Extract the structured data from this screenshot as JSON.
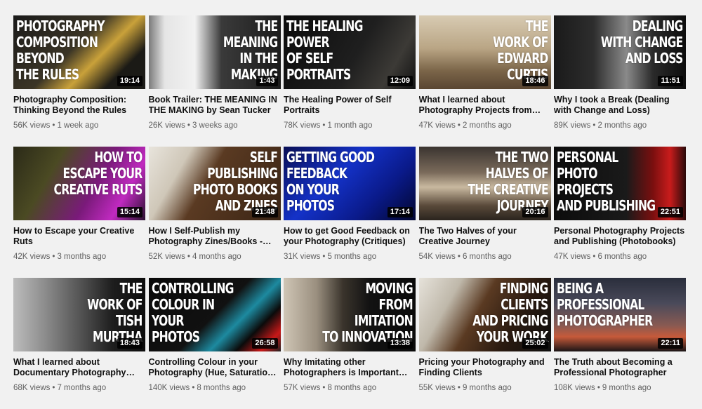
{
  "videos": [
    {
      "thumb_text": "PHOTOGRAPHY\nCOMPOSITION\nBEYOND\nTHE RULES",
      "align": "left",
      "bg": "linear-gradient(135deg,#1a1a1a 0%,#3b3526 45%,#c9a13a 62%,#1b1a16 80%)",
      "duration": "19:14",
      "title": "Photography Composition: Thinking Beyond the Rules",
      "views": "56K views",
      "age": "1 week ago"
    },
    {
      "thumb_text": "THE\nMEANING\nIN THE\nMAKING",
      "align": "right",
      "bg": "linear-gradient(90deg,#7b7b7b 0%,#e5e5e5 12%,#f2f2f2 35%,#3a3a3a 55%,#1c1c1c 100%)",
      "duration": "1:43",
      "title": "Book Trailer: THE MEANING IN THE MAKING by Sean Tucker",
      "views": "26K views",
      "age": "3 weeks ago"
    },
    {
      "thumb_text": "THE HEALING\nPOWER\nOF SELF\nPORTRAITS",
      "align": "left",
      "bg": "linear-gradient(120deg,#0b0b0b 0%,#1f1f1f 55%,#3c3a36 80%,#111 100%)",
      "duration": "12:09",
      "title": "The Healing Power of Self Portraits",
      "views": "78K views",
      "age": "1 month ago"
    },
    {
      "thumb_text": "THE\nWORK OF\nEDWARD\nCURTIS",
      "align": "right",
      "bg": "linear-gradient(180deg,#d8cbb3 0%,#b9a584 45%,#7b6549 75%,#5a4632 100%)",
      "duration": "18:46",
      "title": "What I learned about Photography Projects from Edward Curtis",
      "views": "47K views",
      "age": "2 months ago"
    },
    {
      "thumb_text": "DEALING\nWITH CHANGE\nAND LOSS",
      "align": "right",
      "bg": "linear-gradient(90deg,#1a1a1a 0%,#2d2d2d 30%,#8a8a8a 55%,#2a2a2a 75%,#0d0d0d 100%)",
      "duration": "11:51",
      "title": "Why I took a Break (Dealing with Change and Loss)",
      "views": "89K views",
      "age": "2 months ago"
    },
    {
      "thumb_text": "HOW TO\nESCAPE YOUR\nCREATIVE RUTS",
      "align": "right",
      "bg": "linear-gradient(120deg,#2b2a18 0%,#4b4a23 30%,#7a1a7a 60%,#c02ac0 80%,#2a1030 100%)",
      "duration": "15:14",
      "title": "How to Escape your Creative Ruts",
      "views": "42K views",
      "age": "3 months ago"
    },
    {
      "thumb_text": "SELF\nPUBLISHING\nPHOTO BOOKS\nAND ZINES",
      "align": "right",
      "bg": "linear-gradient(120deg,#e8e4dc 0%,#cfc7b8 25%,#5a3a22 45%,#3a2414 100%)",
      "duration": "21:48",
      "title": "How I Self-Publish my Photography Zines/Books - Self Publishing",
      "views": "52K views",
      "age": "4 months ago"
    },
    {
      "thumb_text": "GETTING GOOD\nFEEDBACK\nON YOUR\nPHOTOS",
      "align": "left",
      "bg": "linear-gradient(135deg,#0a0f55 0%,#1432c8 40%,#0a1a8a 70%,#020630 100%)",
      "duration": "17:14",
      "title": "How to get Good Feedback on your Photography (Critiques)",
      "views": "31K views",
      "age": "5 months ago"
    },
    {
      "thumb_text": "THE TWO\nHALVES OF\nTHE CREATIVE\nJOURNEY",
      "align": "right",
      "bg": "linear-gradient(180deg,#3a3430 0%,#7a6a5a 35%,#c9b9a0 55%,#5a4a3a 80%,#2a241e 100%)",
      "duration": "20:16",
      "title": "The Two Halves of your Creative Journey",
      "views": "54K views",
      "age": "6 months ago"
    },
    {
      "thumb_text": "PERSONAL\nPHOTO\nPROJECTS\nAND PUBLISHING",
      "align": "left",
      "bg": "linear-gradient(90deg,#0c0c0c 0%,#1a1a1a 55%,#7a0f0f 75%,#c81c1c 88%,#2a0a0a 100%)",
      "duration": "22:51",
      "title": "Personal Photography Projects and Publishing (Photobooks)",
      "views": "47K views",
      "age": "6 months ago"
    },
    {
      "thumb_text": "THE\nWORK OF\nTISH\nMURTHA",
      "align": "right",
      "bg": "linear-gradient(90deg,#bdbdbd 0%,#8a8a8a 25%,#555 50%,#1e1e1e 75%,#0c0c0c 100%)",
      "duration": "18:43",
      "title": "What I learned about Documentary Photography from Tish Murtha",
      "views": "68K views",
      "age": "7 months ago"
    },
    {
      "thumb_text": "CONTROLLING\nCOLOUR IN\nYOUR\nPHOTOS",
      "align": "left",
      "bg": "linear-gradient(135deg,#0a0a0a 0%,#111 50%,#1d8aa0 65%,#0b0b0b 78%,#c81818 90%,#222 100%)",
      "duration": "26:58",
      "title": "Controlling Colour in your Photography (Hue, Saturation, Luminance)",
      "views": "140K views",
      "age": "8 months ago"
    },
    {
      "thumb_text": "MOVING\nFROM\nIMITATION\nTO INNOVATION",
      "align": "right",
      "bg": "linear-gradient(90deg,#cfc5b5 0%,#9a8f7f 25%,#3a342c 45%,#121212 65%,#0a0a0a 100%)",
      "duration": "13:38",
      "title": "Why Imitating other Photographers is Important (And how to grow)",
      "views": "57K views",
      "age": "8 months ago"
    },
    {
      "thumb_text": "FINDING\nCLIENTS\nAND PRICING\nYOUR WORK",
      "align": "right",
      "bg": "linear-gradient(120deg,#e6e2da 0%,#bfb8aa 25%,#5a3a22 45%,#2a1a10 70%,#0e0e0e 100%)",
      "duration": "25:02",
      "title": "Pricing your Photography and Finding Clients",
      "views": "55K views",
      "age": "9 months ago"
    },
    {
      "thumb_text": "BEING A\nPROFESSIONAL\nPHOTOGRAPHER",
      "align": "left",
      "bg": "linear-gradient(180deg,#2a2e3c 0%,#4a4a5a 35%,#8a5a52 65%,#c65a3a 80%,#1a1416 100%)",
      "duration": "22:11",
      "title": "The Truth about Becoming a Professional Photographer",
      "views": "108K views",
      "age": "9 months ago"
    }
  ]
}
